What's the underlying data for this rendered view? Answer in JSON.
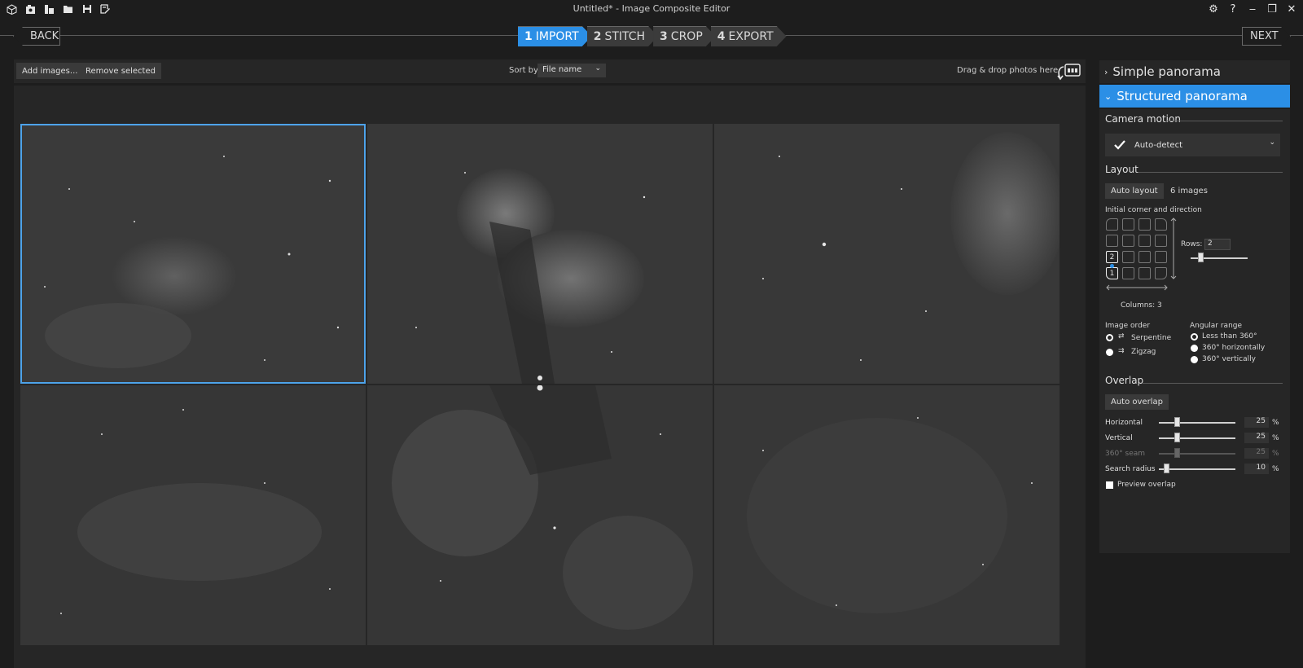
{
  "window": {
    "title": "Untitled* - Image Composite Editor",
    "controls": {
      "settings": "⚙",
      "help": "?",
      "minimize": "‒",
      "restore": "❐",
      "close": "✕"
    }
  },
  "nav": {
    "back": "BACK",
    "next": "NEXT",
    "steps": [
      {
        "num": "1",
        "label": "IMPORT"
      },
      {
        "num": "2",
        "label": "STITCH"
      },
      {
        "num": "3",
        "label": "CROP"
      },
      {
        "num": "4",
        "label": "EXPORT"
      }
    ]
  },
  "toolbar": {
    "add_images": "Add images...",
    "remove_selected": "Remove selected",
    "sort_label": "Sort by",
    "sort_value": "File name",
    "drag_drop": "Drag & drop photos here"
  },
  "side": {
    "simple": "Simple panorama",
    "structured": "Structured panorama",
    "camera_motion": {
      "title": "Camera motion",
      "value": "Auto-detect"
    },
    "layout": {
      "title": "Layout",
      "auto_layout": "Auto layout",
      "image_count": "6 images",
      "initial_corner": "Initial corner and direction",
      "rows_label": "Rows:",
      "rows_value": "2",
      "columns_label": "Columns: 3",
      "cell_2": "2",
      "cell_1": "1"
    },
    "image_order": {
      "title": "Image order",
      "serpentine": "Serpentine",
      "zigzag": "Zigzag"
    },
    "angular_range": {
      "title": "Angular range",
      "less": "Less than 360°",
      "horiz": "360° horizontally",
      "vert": "360° vertically"
    },
    "overlap": {
      "title": "Overlap",
      "auto_overlap": "Auto overlap",
      "horizontal": {
        "label": "Horizontal",
        "value": "25",
        "unit": "%"
      },
      "vertical": {
        "label": "Vertical",
        "value": "25",
        "unit": "%"
      },
      "seam": {
        "label": "360° seam",
        "value": "25",
        "unit": "%"
      },
      "search": {
        "label": "Search radius",
        "value": "10",
        "unit": "%"
      },
      "preview": "Preview overlap"
    }
  }
}
